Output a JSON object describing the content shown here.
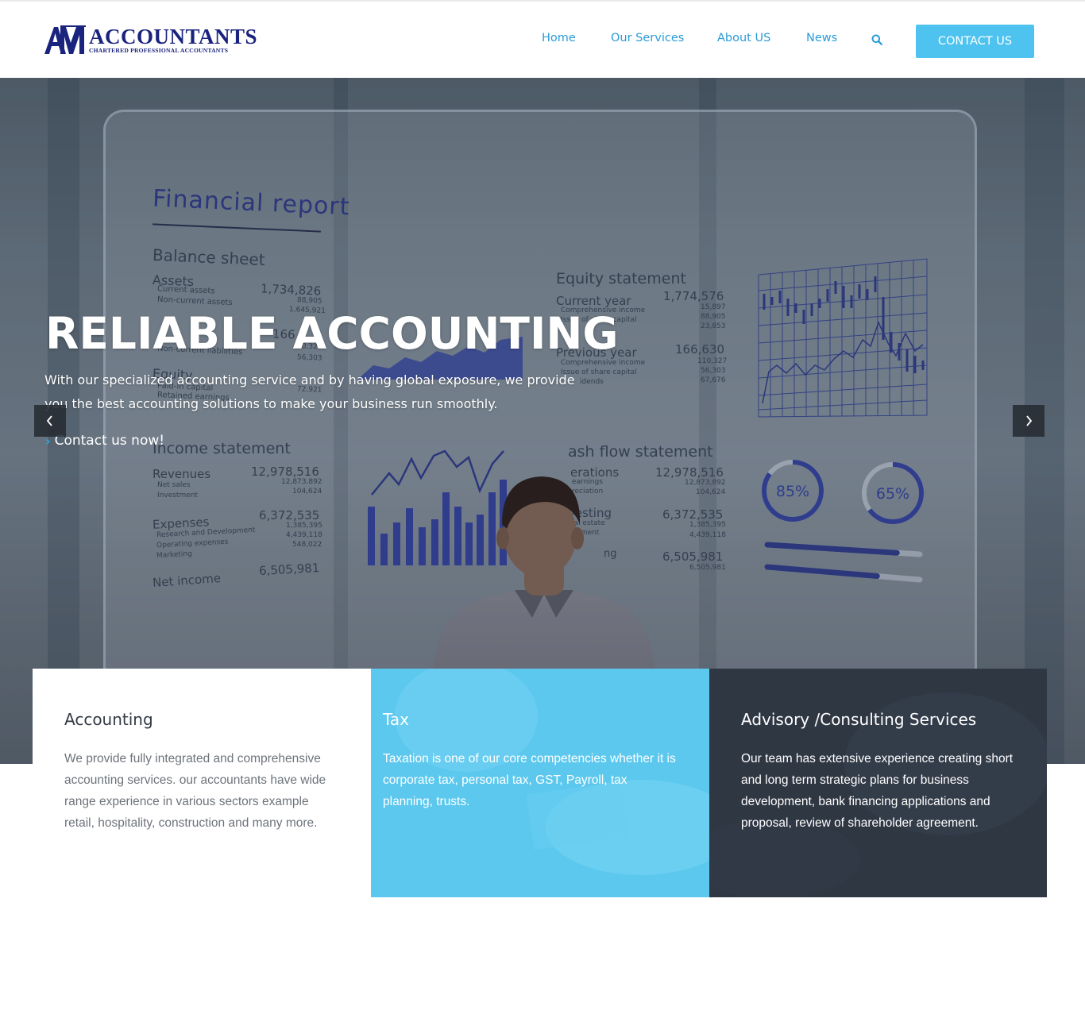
{
  "brand": {
    "logo_mark": "AM",
    "name": "ACCOUNTANTS",
    "tagline": "CHARTERED PROFESSIONAL ACCOUNTANTS",
    "primary_color": "#1a237e",
    "accent_color": "#4ec3ef"
  },
  "nav": {
    "items": [
      {
        "label": "Home"
      },
      {
        "label": "Our Services"
      },
      {
        "label": "About US"
      },
      {
        "label": "News"
      }
    ],
    "search_icon": "search-icon",
    "contact_label": "CONTACT US"
  },
  "hero": {
    "heading": "RELIABLE ACCOUNTING",
    "description": "With our specialized accounting service and by having global exposure, we provide you the best accounting solutions to make your business run smoothly.",
    "cta": "Contact us now!",
    "prev_icon": "chevron-left-icon",
    "next_icon": "chevron-right-icon",
    "background": {
      "report_title": "Financial report",
      "balance_sheet": "Balance sheet",
      "assets": "Assets",
      "assets_value": "1,734,826",
      "current_assets": "Current assets",
      "current_assets_value": "88,905",
      "non_current_assets": "Non-current assets",
      "non_current_assets_value": "1,645,921",
      "liabilities_value": "166",
      "non_current_liabilities": "Non-current liabilities",
      "liab_v1": "10,327",
      "liab_v2": "56,303",
      "equity": "Equity",
      "paid_in_capital": "Paid-in capital",
      "retained_earnings": "Retained earnings",
      "equity_v1": "72,921",
      "equity_statement": "Equity statement",
      "current_year": "Current year",
      "current_year_value": "1,774,576",
      "comprehensive_income": "Comprehensive income",
      "share_capital": "Issue of share capital",
      "cy_v1": "15,897",
      "cy_v2": "88,905",
      "cy_v3": "23,853",
      "previous_year": "Previous year",
      "previous_year_value": "166,630",
      "py_comprehensive": "Comprehensive income",
      "py_share_capital": "Issue of share capital",
      "py_v1": "110,327",
      "py_v2": "56,303",
      "py_v3": "67,676",
      "dividends": "idends",
      "income_statement": "Income statement",
      "revenues": "Revenues",
      "revenues_value": "12,978,516",
      "net_sales": "Net sales",
      "investment": "Investment",
      "rev_v1": "12,873,892",
      "rev_v2": "104,624",
      "expenses": "Expenses",
      "expenses_value": "6,372,535",
      "research": "Research and Development",
      "operating": "Operating expenses",
      "marketing": "Marketing",
      "exp_v1": "1,385,395",
      "exp_v2": "4,439,118",
      "exp_v3": "548,022",
      "net_income": "Net income",
      "net_income_value": "6,505,981",
      "cash_flow": "ash flow statement",
      "operations": "erations",
      "cf_value": "12,978,516",
      "earnings": "earnings",
      "depreciation": "reciation",
      "cf_v1": "12,873,892",
      "cf_v2": "104,624",
      "investing": "vesting",
      "real_estate": "eal estate",
      "equipment": "uipment",
      "inv_value": "6,372,535",
      "inv_v1": "1,385,395",
      "inv_v2": "4,439,118",
      "fin_label": "ng",
      "fin_value": "6,505,981",
      "fin_v1": "6,505,981",
      "donut1": "85%",
      "donut2": "65%",
      "donut1_fraction": 0.85,
      "donut2_fraction": 0.65,
      "progress1_fraction": 0.85,
      "progress2_fraction": 0.72
    }
  },
  "services": [
    {
      "title": "Accounting",
      "text": "We provide fully integrated and comprehensive accounting services. our accountants have wide range experience in various sectors example retail, hospitality, construction and many more."
    },
    {
      "title": "Tax",
      "text": "Taxation is one of our core competencies whether it is corporate tax, personal tax, GST, Payroll, tax planning, trusts."
    },
    {
      "title": "Advisory /Consulting Services",
      "text": "Our team has extensive experience creating short and long term strategic plans for business development, bank financing applications and proposal, review of shareholder agreement."
    }
  ]
}
